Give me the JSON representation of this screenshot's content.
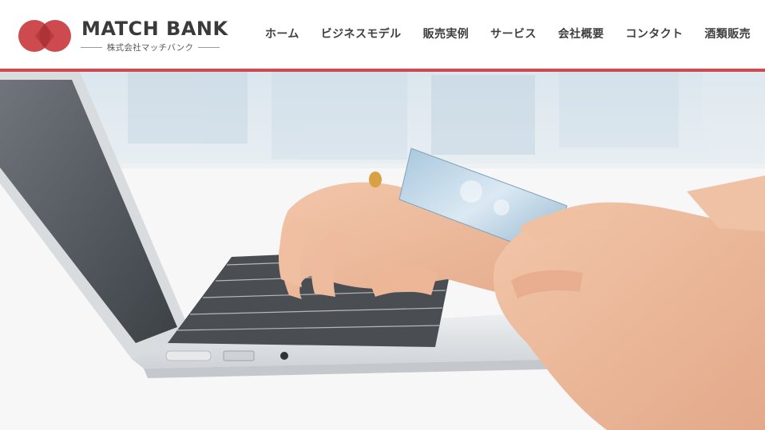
{
  "brand": {
    "name": "MATCH BANK",
    "subtitle": "株式会社マッチバンク",
    "logo_icon": "overlapping-circles-logo-icon",
    "colors": {
      "accent": "#cd4a4f",
      "logo_dark": "#b8383e",
      "text": "#3f3f3f"
    }
  },
  "nav": {
    "items": [
      {
        "label": "ホーム"
      },
      {
        "label": "ビジネスモデル"
      },
      {
        "label": "販売実例"
      },
      {
        "label": "サービス"
      },
      {
        "label": "会社概要"
      },
      {
        "label": "コンタクト"
      },
      {
        "label": "酒類販売"
      }
    ]
  },
  "hero": {
    "image": "laptop-typing-with-credit-card-photo"
  }
}
